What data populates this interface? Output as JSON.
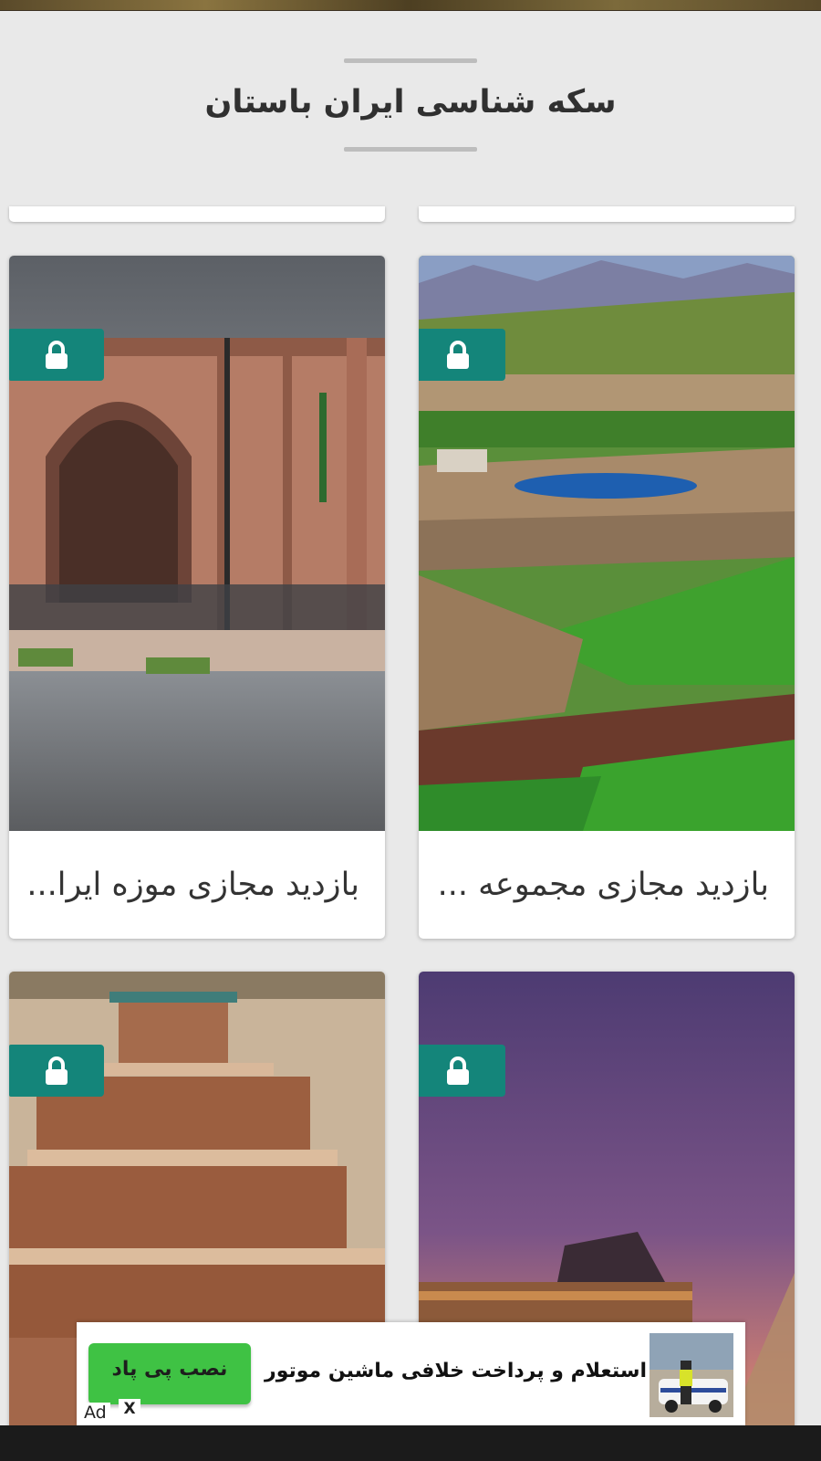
{
  "page": {
    "title": "سکه شناسی ایران باستان"
  },
  "cards": [
    {
      "caption": "بازدید مجازی موزه ایرا...",
      "locked": true,
      "image": "museum-building-photo"
    },
    {
      "caption": "بازدید مجازی مجموعه ...",
      "locked": true,
      "image": "takht-soleyman-landscape-photo"
    },
    {
      "caption": "",
      "locked": true,
      "image": "ziggurat-photo"
    },
    {
      "caption": "",
      "locked": true,
      "image": "louvre-sunset-photo"
    }
  ],
  "ad": {
    "install_label": "نصب پی پاد",
    "text": "استعلام و پرداخت خلافی ماشین موتور",
    "label": "Ad",
    "close": "X"
  },
  "colors": {
    "background": "#e9e9e9",
    "lock_badge": "#14857a",
    "install_button": "#3fc244"
  },
  "icons": [
    "lock-icon"
  ]
}
